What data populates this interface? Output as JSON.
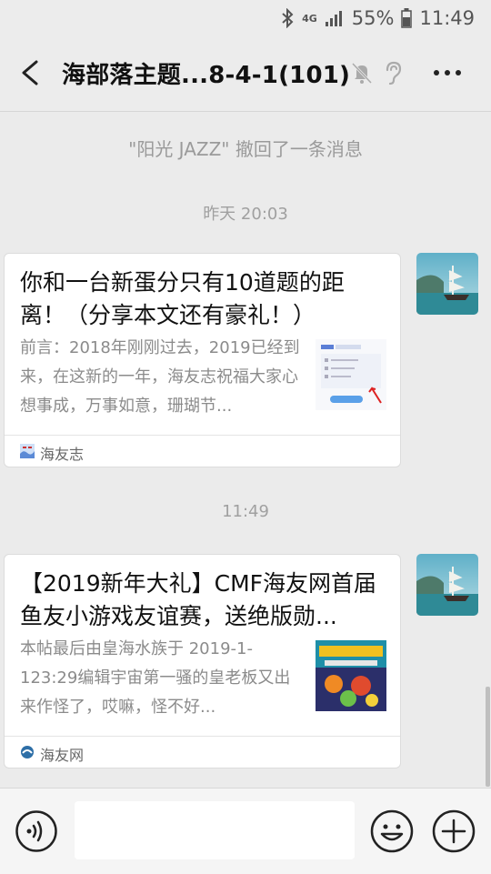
{
  "status": {
    "network": "4G",
    "battery": "55%",
    "time": "11:49"
  },
  "nav": {
    "title": "海部落主题...8-4-1(101)",
    "icons": [
      "back-arrow-icon",
      "mute-bell-icon",
      "ear-icon",
      "more-dots-icon"
    ]
  },
  "messages": {
    "recall_notice": "\"阳光 JAZZ\" 撤回了一条消息",
    "time1": "昨天 20:03",
    "time2": "11:49",
    "card1": {
      "title": "你和一台新蛋分只有10道题的距离！（分享本文还有豪礼！）",
      "desc": "前言：2018年刚刚过去，2019已经到来，在这新的一年，海友志祝福大家心想事成，万事如意，珊瑚节...",
      "source": "海友志"
    },
    "card2": {
      "title": "【2019新年大礼】CMF海友网首届鱼友小游戏友谊赛，送绝版勋...",
      "desc": "本帖最后由皇海水族于 2019-1-123:29编辑宇宙第一骚的皇老板又出来作怪了，哎嘛，怪不好...",
      "source": "海友网"
    }
  },
  "input": {
    "placeholder": ""
  },
  "colors": {
    "background": "#ebebeb",
    "card": "#ffffff",
    "text": "#111111",
    "muted": "#8b8b8b"
  }
}
